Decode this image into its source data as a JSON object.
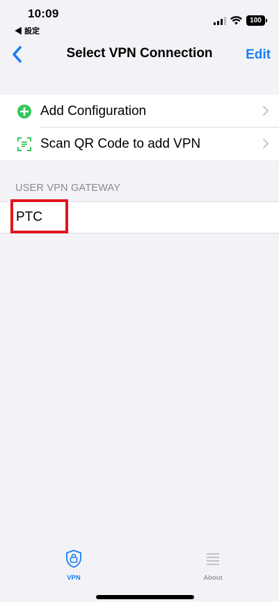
{
  "status_bar": {
    "time": "10:09",
    "back_label": "◀ 設定",
    "battery": "100"
  },
  "nav": {
    "title": "Select VPN Connection",
    "edit_label": "Edit"
  },
  "config_rows": [
    {
      "label": "Add Configuration",
      "icon": "plus-circle-icon",
      "icon_color": "#34c759"
    },
    {
      "label": "Scan QR Code to add VPN",
      "icon": "qr-scan-icon",
      "icon_color": "#34c759"
    }
  ],
  "gateway_section": {
    "header": "USER VPN GATEWAY",
    "items": [
      {
        "label": "PTC"
      }
    ]
  },
  "tabbar": {
    "tabs": [
      {
        "label": "VPN",
        "icon": "shield-lock-icon",
        "active": true
      },
      {
        "label": "About",
        "icon": "list-icon",
        "active": false
      }
    ]
  },
  "colors": {
    "accent": "#1a7cf5",
    "highlight": "#e3141b",
    "background": "#f2f2f7"
  }
}
